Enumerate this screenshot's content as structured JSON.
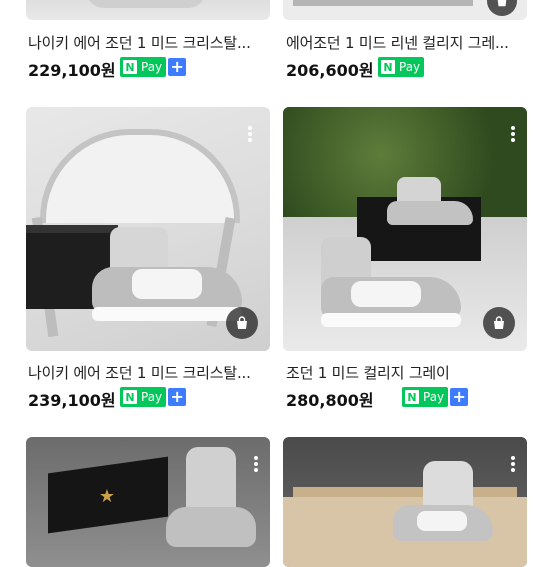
{
  "products": [
    {
      "title": "나이키 에어 조던 1 미드 크리스탈...",
      "price": "229,100원",
      "pay": "Pay",
      "plus": "+",
      "icon": "more-vertical-icon"
    },
    {
      "title": "에어조던 1 미드 리넨 컬리지 그레...",
      "price": "206,600원",
      "pay": "Pay",
      "plus": "+",
      "icon": "more-vertical-icon"
    },
    {
      "title": "나이키 에어 조던 1 미드 크리스탈...",
      "price": "239,100원",
      "pay": "Pay",
      "plus": "+",
      "icon": "shopping-bag-icon"
    },
    {
      "title": "조던 1 미드 컬리지 그레이",
      "price": "280,800원",
      "pay": "Pay",
      "plus": "+",
      "icon": "shopping-bag-icon"
    }
  ],
  "npay_letter": "N",
  "colors": {
    "npay": "#03c75a",
    "plus": "#3d7bff"
  }
}
